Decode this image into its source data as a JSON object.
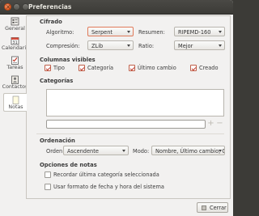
{
  "window": {
    "title": "Preferencias",
    "close_glyph": "×"
  },
  "sidebar": {
    "items": [
      {
        "label": "General",
        "icon": "gear-list-icon"
      },
      {
        "label": "Calendario",
        "icon": "calendar-icon"
      },
      {
        "label": "Tareas",
        "icon": "tasks-checklist-icon"
      },
      {
        "label": "Contactos",
        "icon": "contacts-icon"
      },
      {
        "label": "Notas",
        "icon": "notes-icon"
      }
    ],
    "active": "Notas"
  },
  "cipher": {
    "heading": "Cifrado",
    "algorithm_label": "Algoritmo:",
    "algorithm_value": "Serpent",
    "summary_label": "Resumen:",
    "summary_value": "RIPEMD-160",
    "compression_label": "Compresión:",
    "compression_value": "ZLib",
    "ratio_label": "Ratio:",
    "ratio_value": "Mejor"
  },
  "columns": {
    "heading": "Columnas visibles",
    "items": [
      {
        "label": "Tipo",
        "checked": true
      },
      {
        "label": "Categoría",
        "checked": true
      },
      {
        "label": "Último cambio",
        "checked": true
      },
      {
        "label": "Creado",
        "checked": true
      }
    ]
  },
  "categories": {
    "heading": "Categorías",
    "add_glyph": "+",
    "remove_glyph": "−"
  },
  "ordering": {
    "heading": "Ordenación",
    "order_label": "Orden:",
    "order_value": "Ascendente",
    "mode_label": "Modo:",
    "mode_value": "Nombre, Último cambio, Categoría"
  },
  "note_options": {
    "heading": "Opciones de notas",
    "items": [
      {
        "label": "Recordar última categoría seleccionada",
        "checked": false
      },
      {
        "label": "Usar formato de fecha y hora del sistema",
        "checked": false
      }
    ]
  },
  "footer": {
    "close_label": "Cerrar"
  },
  "colors": {
    "accent": "#c0392b",
    "titlebar": "#3c3b37",
    "window_bg": "#f2f1f0"
  }
}
